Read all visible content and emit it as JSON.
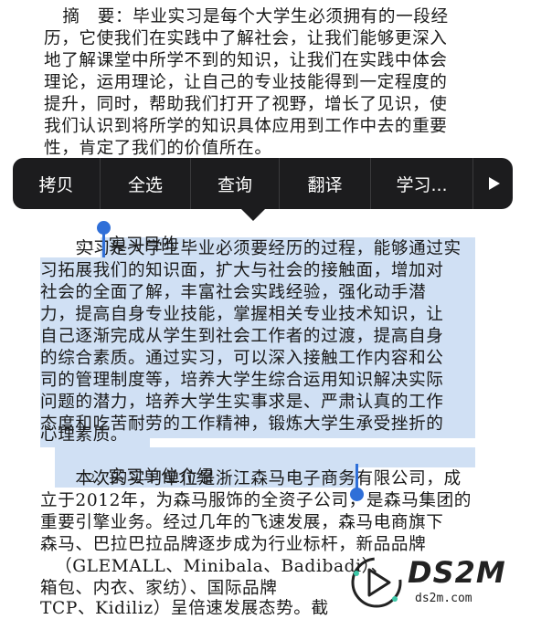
{
  "document": {
    "lines": [
      "　　摘　要：毕业实习是每个大学生必须拥有的一段经",
      "历，它使我们在实践中了解社会，让我们能够更深入",
      "地了解课堂中所学不到的知识，让我们在实践中体会",
      "理论，运用理论，让自己的专业技能得到一定程度的",
      "提升，同时，帮助我们打开了视野，增长了见识，使",
      "我们认识到将所学的知识具体应用到工作中去的重要",
      "性，肯定了我们的价值所在。"
    ],
    "section1_num": "1、",
    "section1_title": "实习目的",
    "section1_lines": [
      "　　实习是大学生毕业必须要经历的过程，能够通过实",
      "习拓展我们的知识面，扩大与社会的接触面，增加对",
      "社会的全面了解，丰富社会实践经验，强化动手潜",
      "力，提高自身专业技能，掌握相关专业技术知识，让",
      "自己逐渐完成从学生到社会工作者的过渡，提高自身",
      "的综合素质。通过实习，可以深入接触工作内容和公",
      "司的管理制度等，培养大学生综合运用知识解决实际",
      "问题的潜力，培养大学生实事求是、严肃认真的工作",
      "态度和吃苦耐劳的工作精神，锻炼大学生承受挫折的",
      "心理素质。"
    ],
    "section2_num": "2、",
    "section2_title": "实习单位介绍",
    "section2_lines": [
      "　　本次的实习单位是浙江森马电子商务有限公司，成",
      "立于2012年，为森马服饰的全资子公司，是森马集团的",
      "重要引擎业务。经过几年的飞速发展，森马电商旗下",
      "森马、巴拉巴拉品牌逐步成为行业标杆，新品品牌",
      "（GLEMALL、Minibala、Badibadi）、",
      "箱包、内衣、家纺）、国际品牌",
      "TCP、Kidiliz）呈倍速发展态势。截"
    ]
  },
  "menu": {
    "items": [
      "拷贝",
      "全选",
      "查询",
      "翻译",
      "学习..."
    ],
    "more_icon": "play-right-icon"
  },
  "watermark": {
    "logo_text": "DS2M",
    "url": "ds2m.com",
    "logo_icon": "play-circle-icon"
  },
  "colors": {
    "selection": "#c8daf2",
    "handle": "#2f6fd8",
    "menu_bg": "#1c1c1e"
  }
}
